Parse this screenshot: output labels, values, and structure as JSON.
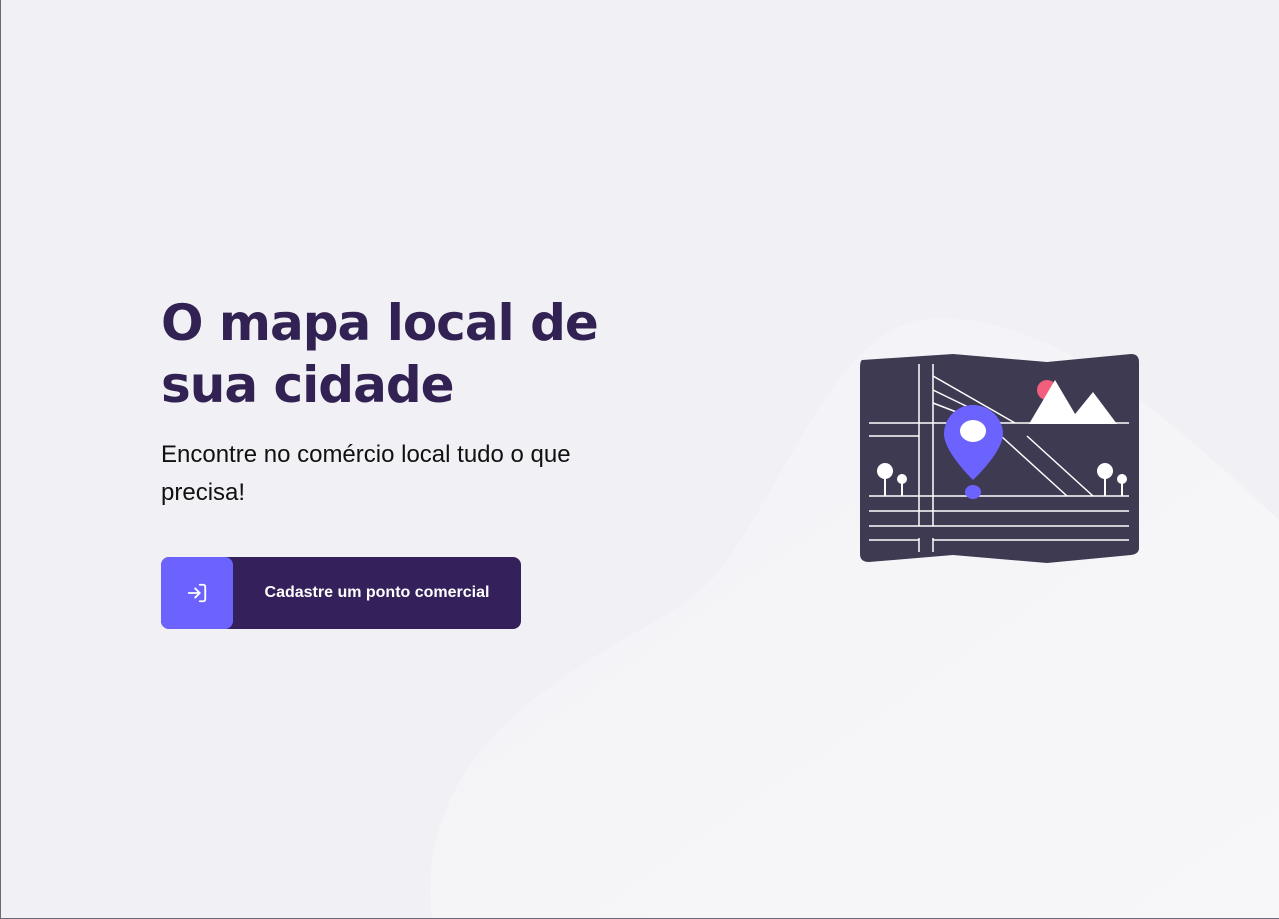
{
  "hero": {
    "title_line1": "O mapa local de",
    "title_line2": "sua cidade",
    "subtitle": "Encontre no comércio local tudo o que precisa!"
  },
  "cta": {
    "label": "Cadastre um ponto comercial",
    "icon": "log-in-icon"
  },
  "illustration": {
    "name": "map-illustration"
  },
  "colors": {
    "background": "#f0f0f5",
    "title": "#322153",
    "button": "#34205a",
    "button_icon_bg": "#6c63ff",
    "map": "#3d3a52",
    "pin": "#6c63ff",
    "sun": "#f25f7c"
  }
}
